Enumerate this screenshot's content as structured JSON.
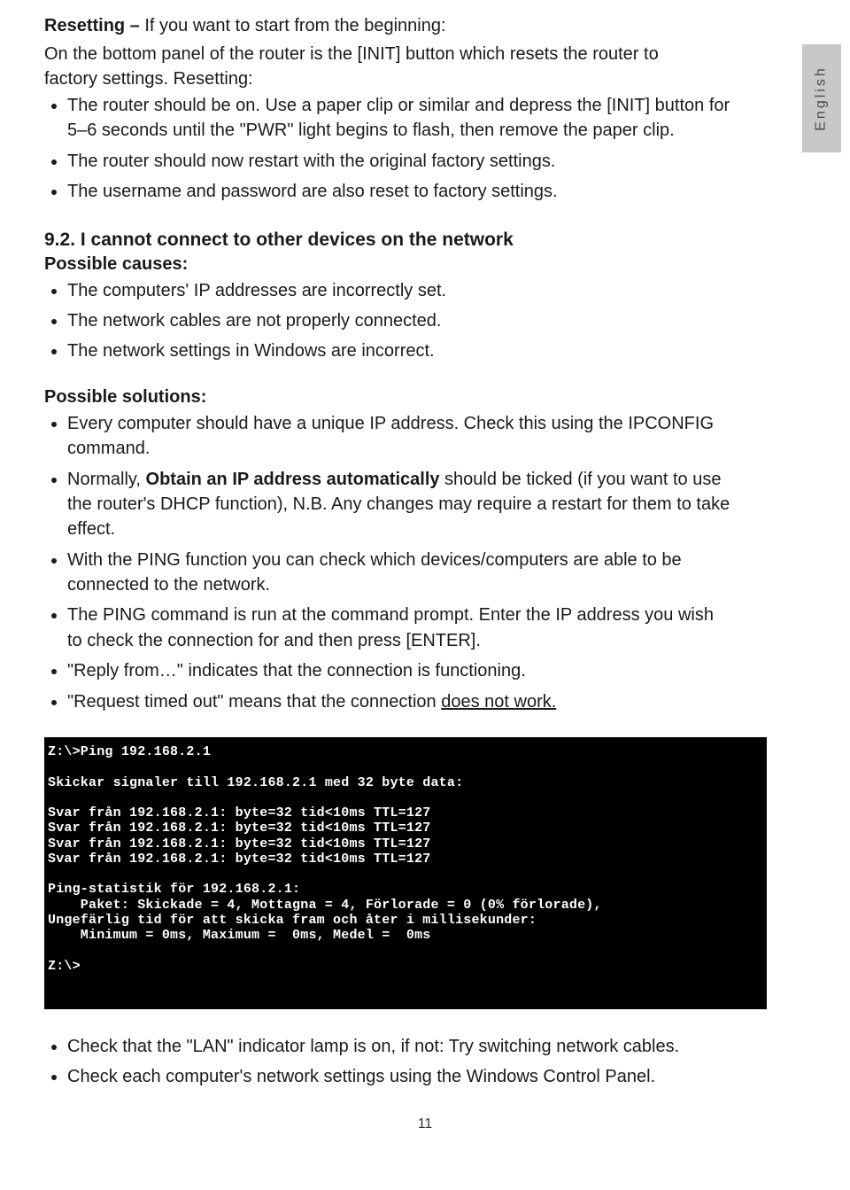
{
  "side_tab": "English",
  "intro": {
    "heading_bold": "Resetting – ",
    "heading_rest": "If you want to start from the beginning:",
    "para": "On the bottom panel of the router is the [INIT] button which resets the router to factory settings. Resetting:",
    "bullets": [
      "The router should be on. Use a paper clip or similar and depress the [INIT] button for 5–6 seconds until the \"PWR\" light begins to flash, then remove the paper clip.",
      "The router should now restart with the original factory settings.",
      "The username and password are also reset to factory settings."
    ]
  },
  "section": {
    "heading": "9.2. I cannot connect to other devices on the network",
    "causes_label": "Possible causes:",
    "causes": [
      "The computers' IP addresses are incorrectly set.",
      "The network cables are not properly connected.",
      "The network settings in Windows are incorrect."
    ],
    "solutions_label": "Possible solutions:",
    "solutions": {
      "s0": "Every computer should have a unique IP address. Check this using the IPCONFIG command.",
      "s1_a": "Normally, ",
      "s1_b": "Obtain an IP address automatically",
      "s1_c": " should be ticked (if you want to use the router's DHCP function), N.B. Any changes may require a restart for them to take effect.",
      "s2": "With the PING function you can check which devices/computers are able to be connected to the network.",
      "s3": "The PING command is run at the command prompt. Enter the IP address you wish to check the connection for and then press [ENTER].",
      "s4": "\"Reply from…\" indicates that the connection is functioning.",
      "s5_a": "\"Request timed out\" means that the connection ",
      "s5_b": "does not work.",
      "s6": "Check that the \"LAN\" indicator lamp is on, if not: Try switching network cables.",
      "s7": "Check each computer's network settings using the Windows Control Panel."
    }
  },
  "terminal": "Z:\\>Ping 192.168.2.1\n\nSkickar signaler till 192.168.2.1 med 32 byte data:\n\nSvar från 192.168.2.1: byte=32 tid<10ms TTL=127\nSvar från 192.168.2.1: byte=32 tid<10ms TTL=127\nSvar från 192.168.2.1: byte=32 tid<10ms TTL=127\nSvar från 192.168.2.1: byte=32 tid<10ms TTL=127\n\nPing-statistik för 192.168.2.1:\n    Paket: Skickade = 4, Mottagna = 4, Förlorade = 0 (0% förlorade),\nUngefärlig tid för att skicka fram och åter i millisekunder:\n    Minimum = 0ms, Maximum =  0ms, Medel =  0ms\n\nZ:\\>",
  "page_number": "11"
}
